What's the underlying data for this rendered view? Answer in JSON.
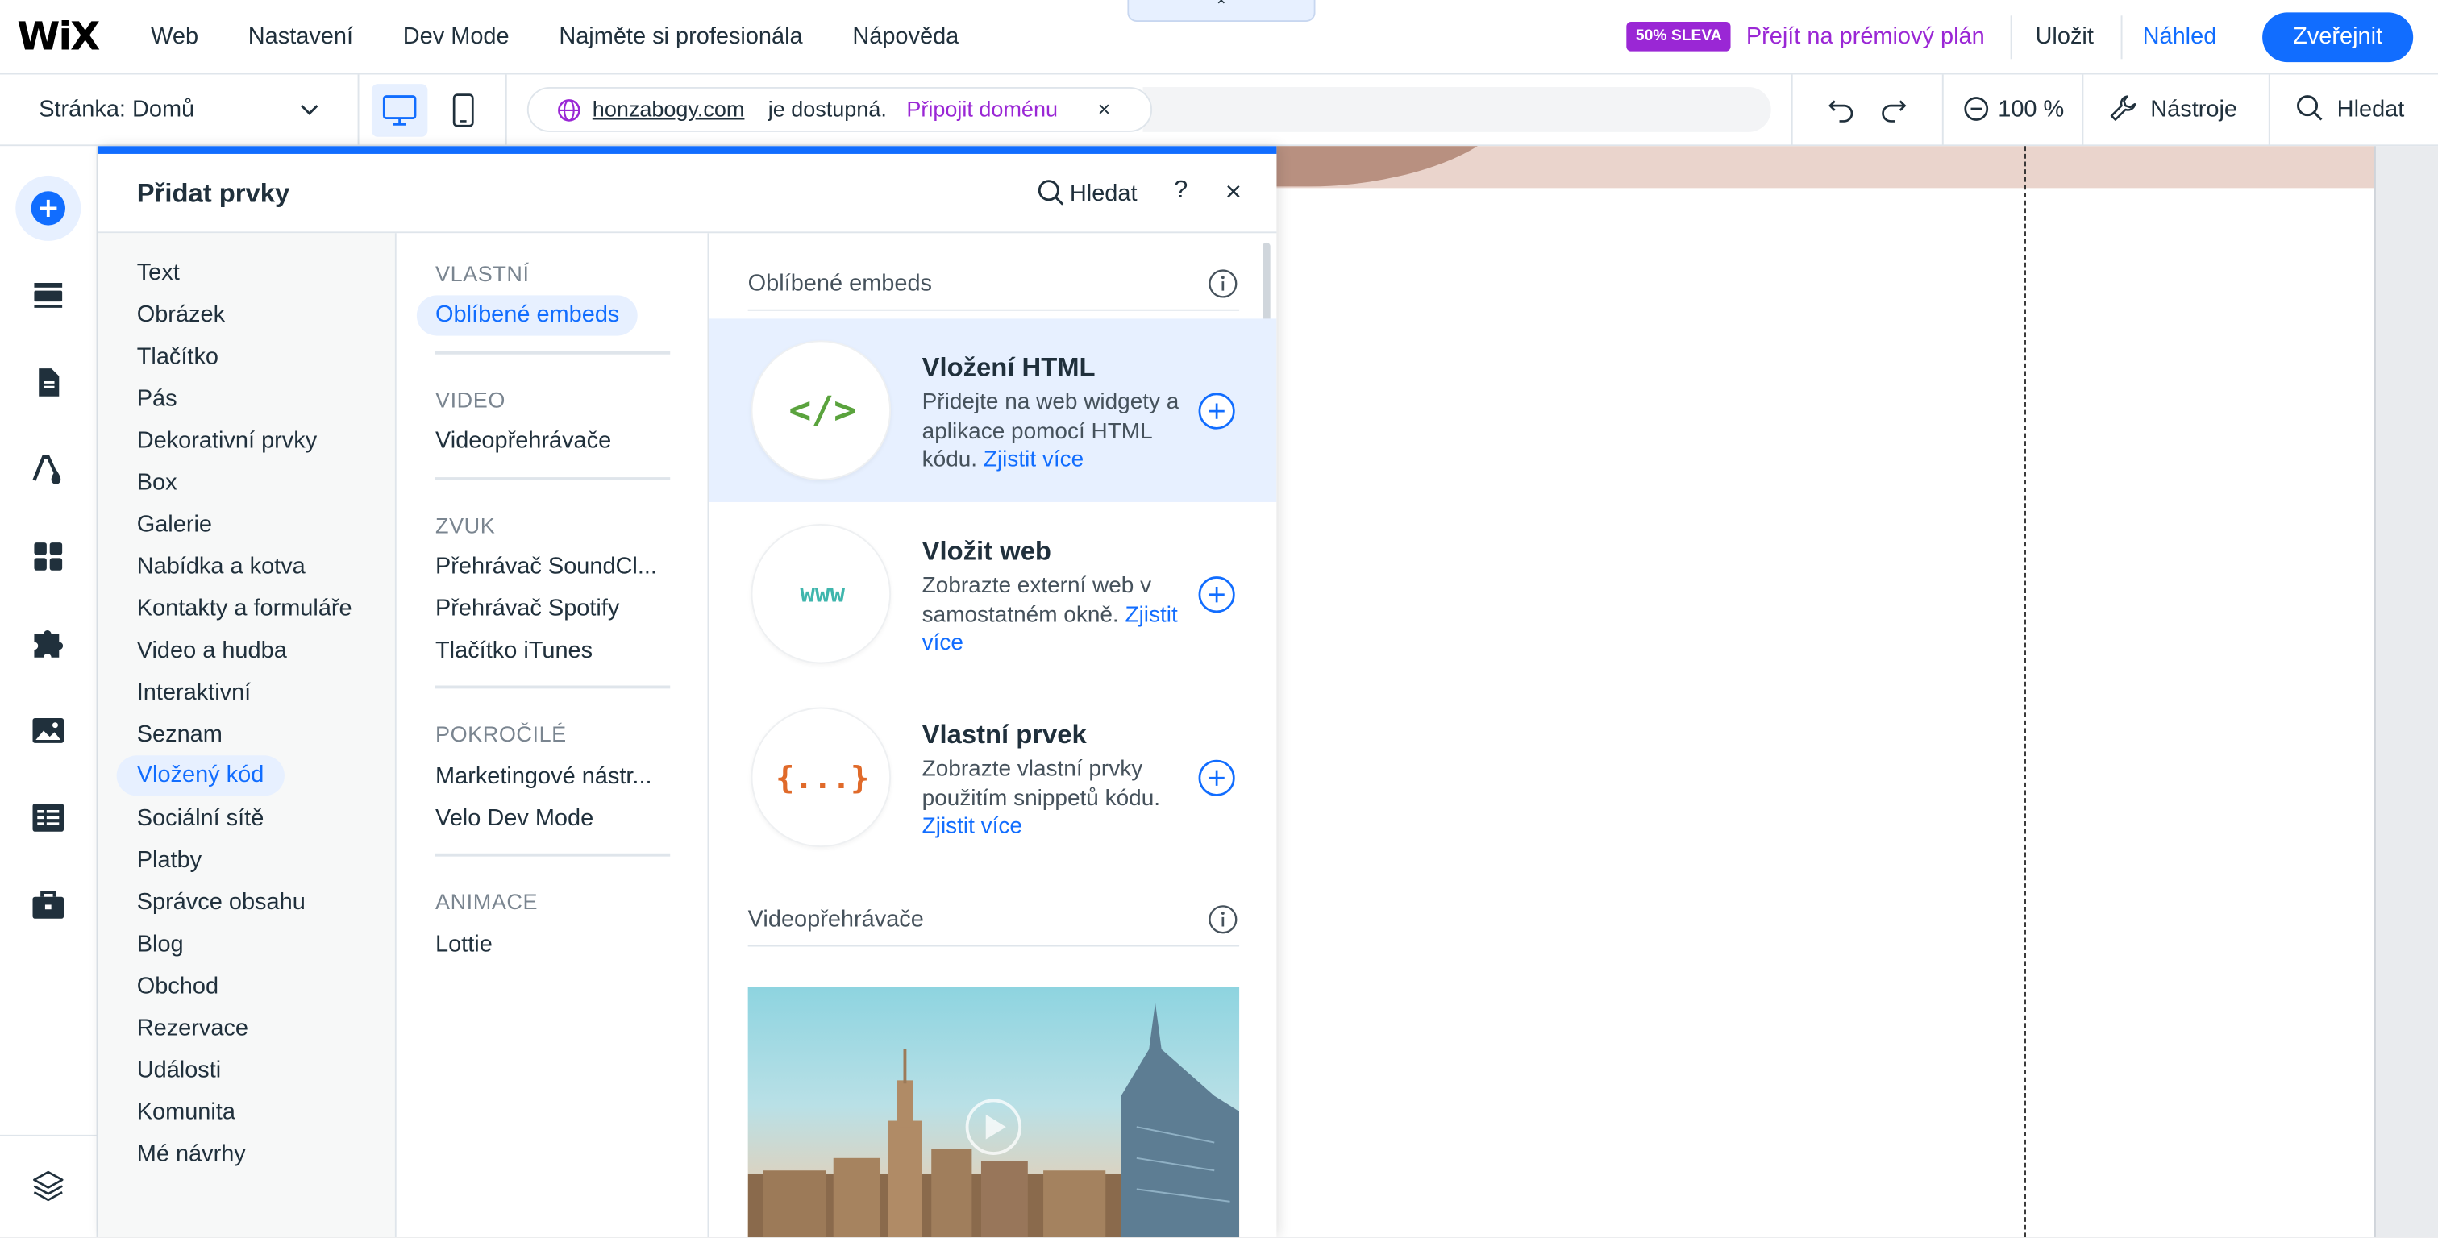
{
  "top_bar": {
    "logo": "WiX",
    "nav": [
      "Web",
      "Nastavení",
      "Dev Mode",
      "Najměte si profesionála",
      "Nápověda"
    ],
    "collapse_glyph": "⌃",
    "promo_badge": "50% SLEVA",
    "premium_link": "Přejít na prémiový plán",
    "save": "Uložit",
    "preview": "Náhled",
    "publish": "Zveřejnit"
  },
  "second_bar": {
    "page_label": "Stránka: Domů",
    "url_domain": "honzabogy.com",
    "url_status": "je dostupná.",
    "url_connect": "Připojit doménu",
    "url_close": "×",
    "zoom": "100 %",
    "tools": "Nástroje",
    "search": "Hledat"
  },
  "rail": {
    "icons": [
      "add-icon",
      "sections-icon",
      "pages-icon",
      "design-icon",
      "apps-icon",
      "business-apps-icon",
      "media-icon",
      "cms-icon",
      "portfolio-icon",
      "layers-icon"
    ]
  },
  "panel": {
    "title": "Přidat prvky",
    "search": "Hledat",
    "help": "?",
    "close": "×",
    "categories": [
      "Text",
      "Obrázek",
      "Tlačítko",
      "Pás",
      "Dekorativní prvky",
      "Box",
      "Galerie",
      "Nabídka a kotva",
      "Kontakty a formuláře",
      "Video a hudba",
      "Interaktivní",
      "Seznam",
      "Vložený kód",
      "Sociální sítě",
      "Platby",
      "Správce obsahu",
      "Blog",
      "Obchod",
      "Rezervace",
      "Události",
      "Komunita",
      "Mé návrhy"
    ],
    "active_category": "Vložený kód",
    "subgroups": [
      {
        "heading": "VLASTNÍ",
        "items": [
          "Oblíbené embeds"
        ]
      },
      {
        "heading": "VIDEO",
        "items": [
          "Videopřehrávače"
        ]
      },
      {
        "heading": "ZVUK",
        "items": [
          "Přehrávač SoundCl...",
          "Přehrávač Spotify",
          "Tlačítko iTunes"
        ]
      },
      {
        "heading": "POKROČILÉ",
        "items": [
          "Marketingové nástr...",
          "Velo Dev Mode"
        ]
      },
      {
        "heading": "ANIMACE",
        "items": [
          "Lottie"
        ]
      }
    ],
    "content": {
      "section1_title": "Oblíbené embeds",
      "cards": [
        {
          "title": "Vložení HTML",
          "desc": "Přidejte na web widgety a aplikace pomocí HTML kódu.",
          "link": "Zjistit více",
          "glyph": "</>",
          "glyph_color": "#5aa33d"
        },
        {
          "title": "Vložit web",
          "desc": "Zobrazte externí web v samostatném okně.",
          "link": "Zjistit více",
          "glyph": "www",
          "glyph_color": "#3fb6ad"
        },
        {
          "title": "Vlastní prvek",
          "desc": "Zobrazte vlastní prvky použitím snippetů kódu.",
          "link": "Zjistit více",
          "glyph": "{...}",
          "glyph_color": "#e06a2a"
        }
      ],
      "section2_title": "Videopřehrávače"
    }
  },
  "colors": {
    "accent": "#116dff",
    "premium": "#9a27d5",
    "highlight": "#e7f0ff"
  }
}
